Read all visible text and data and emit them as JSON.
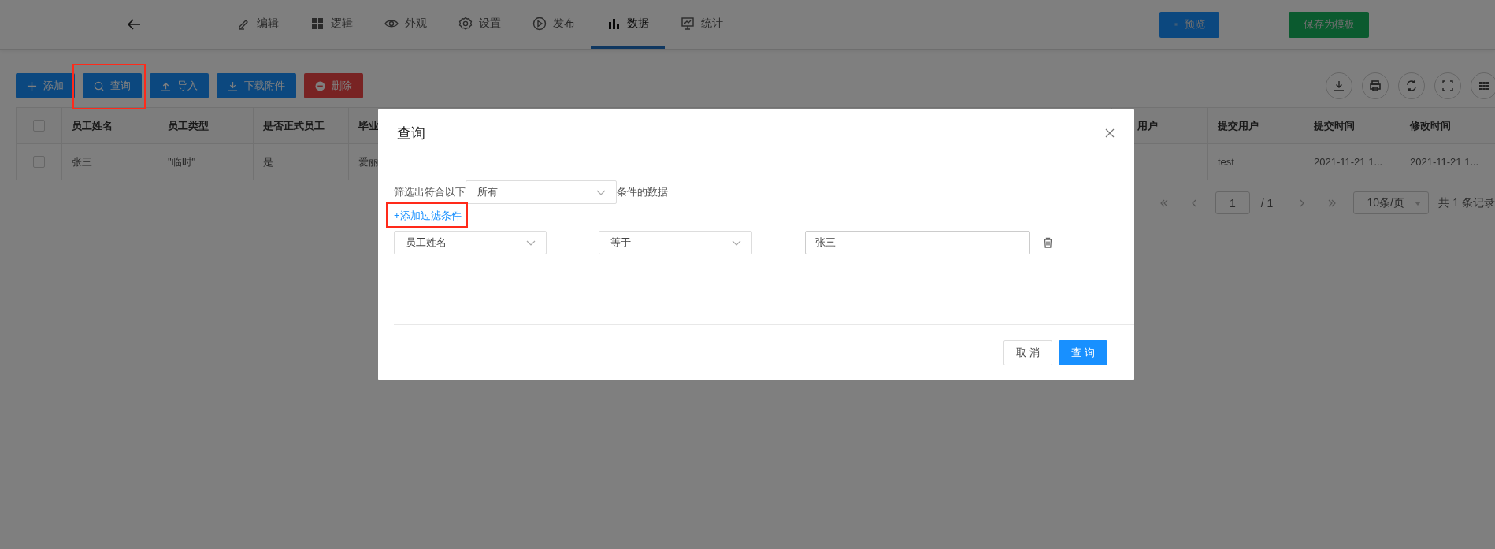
{
  "nav": {
    "tabs": [
      {
        "label": "编辑",
        "kind": "edit",
        "selected": false
      },
      {
        "label": "逻辑",
        "kind": "logic",
        "selected": false
      },
      {
        "label": "外观",
        "kind": "look",
        "selected": false
      },
      {
        "label": "设置",
        "kind": "settings",
        "selected": false
      },
      {
        "label": "发布",
        "kind": "publish",
        "selected": false
      },
      {
        "label": "数据",
        "kind": "data",
        "selected": true
      },
      {
        "label": "统计",
        "kind": "stats",
        "selected": false
      }
    ],
    "actions": [
      {
        "label": "预览",
        "kind": "preview"
      },
      {
        "label": "保存为模板",
        "kind": "save"
      }
    ]
  },
  "toolbar": {
    "buttons": [
      {
        "label": "添加",
        "kind": "add",
        "highlighted": false
      },
      {
        "label": "查询",
        "kind": "search",
        "highlighted": true
      },
      {
        "label": "导入",
        "kind": "import",
        "highlighted": false
      },
      {
        "label": "下载附件",
        "kind": "download",
        "highlighted": false
      },
      {
        "label": "删除",
        "kind": "delete",
        "highlighted": false
      }
    ]
  },
  "table": {
    "all_checked": false,
    "columns": [
      "员工姓名",
      "员工类型",
      "是否正式员工",
      "毕业",
      "用户",
      "提交用户",
      "提交时间",
      "修改时间"
    ],
    "rows": [
      {
        "checked": false,
        "cells": [
          "张三",
          "\"临时\"",
          "是",
          "爱丽",
          null,
          "test",
          "2021-11-21 1...",
          "2021-11-21 1..."
        ]
      }
    ]
  },
  "pagination": {
    "page": "1",
    "total_pages": "/ 1",
    "page_size": "10条/页",
    "summary": "共 1 条记录"
  },
  "dialog": {
    "title": "查询",
    "match_prefix": "筛选出符合以下",
    "match_mode": "所有",
    "match_suffix": "条件的数据",
    "add_filter": {
      "label": "+添加过滤条件",
      "highlighted": true
    },
    "filters": [
      {
        "field": "员工姓名",
        "operator": "等于",
        "value": "张三"
      }
    ],
    "buttons": [
      {
        "label": "取 消",
        "kind": "secondary"
      },
      {
        "label": "查 询",
        "kind": "primary"
      }
    ]
  }
}
